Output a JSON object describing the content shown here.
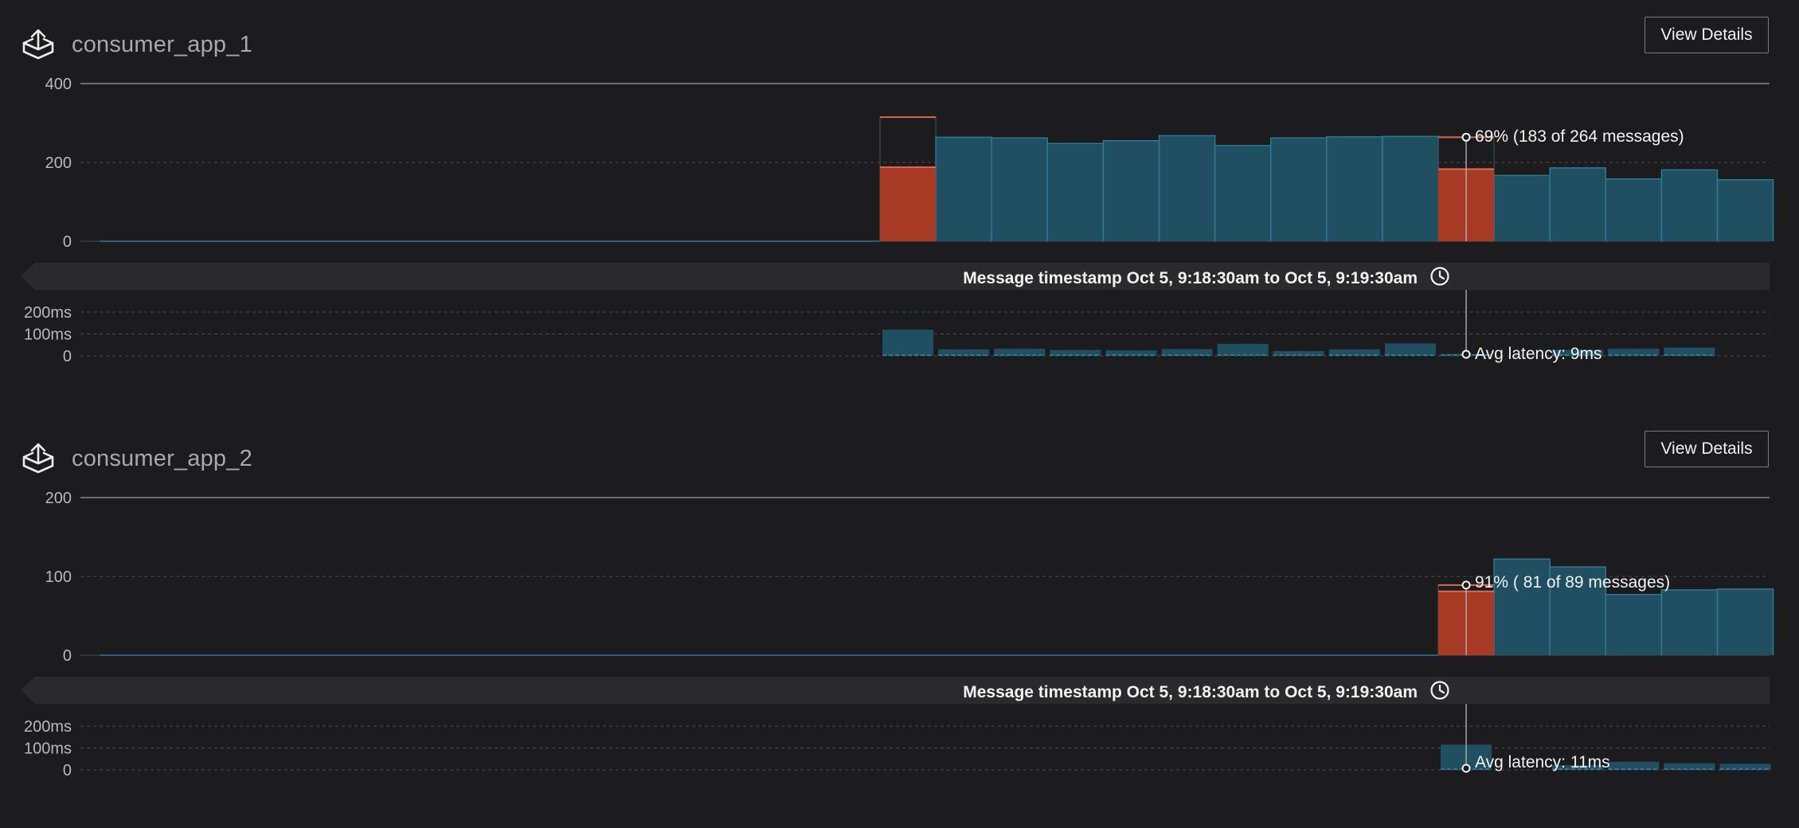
{
  "colors": {
    "background": "#1c1c1e",
    "bar_fill": "#1f4f61",
    "bar_stroke": "#2f7891",
    "error_fill": "#a73a24",
    "error_stroke": "#d86a4f",
    "grid": "#4d4d50",
    "band": "#2a2a2d"
  },
  "panels": [
    {
      "title": "consumer_app_1",
      "icon": "upload-tray-icon",
      "view_details_label": "View Details",
      "timestamp_label": "Message timestamp Oct 5, 9:18:30am to Oct 5, 9:19:30am",
      "clock_icon": "clock-icon",
      "tooltip_main": "69% (183 of 264 messages)",
      "tooltip_latency": "Avg latency: 9ms",
      "chart_data": {
        "type": "bar",
        "x_buckets": 30,
        "ylim": [
          0,
          400
        ],
        "y_ticks": [
          "400",
          "200",
          "0"
        ],
        "y_tick_values": [
          400,
          200,
          0
        ],
        "series": [
          {
            "name": "",
            "start_bucket": 14,
            "values": [
              315,
              264,
              262,
              248,
              255,
              268,
              243,
              262,
              265,
              266,
              264,
              167,
              186,
              158,
              181,
              156
            ]
          },
          {
            "name": "",
            "start_bucket": 14,
            "values": [
              188,
              null,
              null,
              null,
              null,
              null,
              null,
              null,
              null,
              null,
              183,
              null,
              null,
              null,
              null,
              null
            ]
          }
        ],
        "highlight_bucket": 24
      },
      "latency_data": {
        "type": "bar",
        "ylim": [
          0,
          200
        ],
        "y_ticks": [
          "200ms",
          "100ms",
          "0"
        ],
        "y_tick_values": [
          200,
          100,
          0
        ],
        "start_bucket": 14,
        "values": [
          120,
          30,
          33,
          27,
          25,
          31,
          55,
          22,
          30,
          57,
          9,
          null,
          28,
          33,
          38
        ],
        "highlight_bucket": 24
      }
    },
    {
      "title": "consumer_app_2",
      "icon": "upload-tray-icon",
      "view_details_label": "View Details",
      "timestamp_label": "Message timestamp Oct 5, 9:18:30am to Oct 5, 9:19:30am",
      "clock_icon": "clock-icon",
      "tooltip_main": "91% ( 81 of 89 messages)",
      "tooltip_latency": "Avg latency: 11ms",
      "chart_data": {
        "type": "bar",
        "x_buckets": 30,
        "ylim": [
          0,
          200
        ],
        "y_ticks": [
          "200",
          "100",
          "0"
        ],
        "y_tick_values": [
          200,
          100,
          0
        ],
        "series": [
          {
            "name": "",
            "start_bucket": 24,
            "values": [
              89,
              122,
              112,
              77,
              83,
              84
            ]
          },
          {
            "name": "",
            "start_bucket": 24,
            "values": [
              81,
              null,
              null,
              null,
              null,
              null
            ]
          }
        ],
        "highlight_bucket": 24
      },
      "latency_data": {
        "type": "bar",
        "ylim": [
          0,
          200
        ],
        "y_ticks": [
          "200ms",
          "100ms",
          "0"
        ],
        "y_tick_values": [
          200,
          100,
          0
        ],
        "start_bucket": 24,
        "values": [
          115,
          null,
          22,
          37,
          30,
          28
        ],
        "highlight_bucket": 24
      }
    }
  ]
}
